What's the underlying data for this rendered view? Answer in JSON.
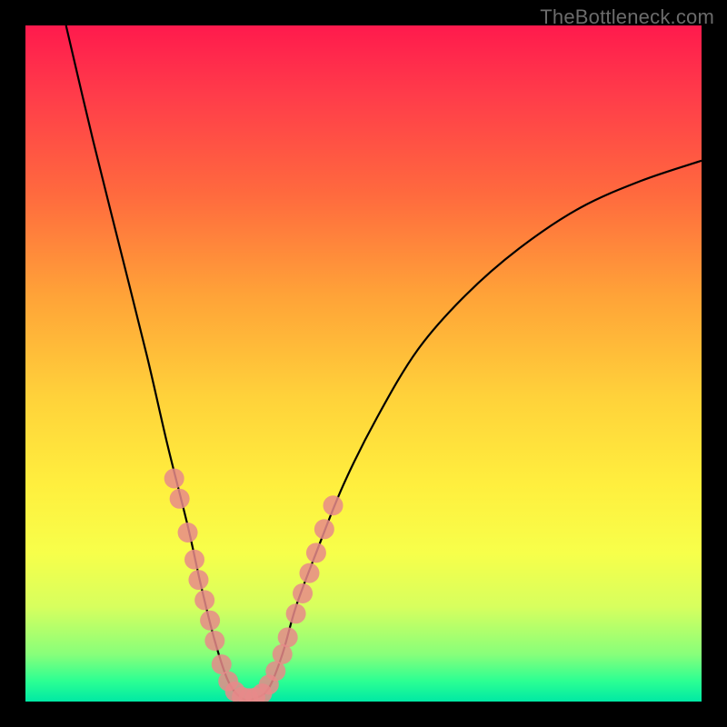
{
  "watermark": "TheBottleneck.com",
  "chart_data": {
    "type": "line",
    "title": "",
    "xlabel": "",
    "ylabel": "",
    "xlim": [
      0,
      100
    ],
    "ylim": [
      0,
      100
    ],
    "curve": {
      "name": "bottleneck-curve",
      "points": [
        {
          "x": 6,
          "y": 100
        },
        {
          "x": 10,
          "y": 83
        },
        {
          "x": 14,
          "y": 67
        },
        {
          "x": 18,
          "y": 51
        },
        {
          "x": 21,
          "y": 38
        },
        {
          "x": 24,
          "y": 26
        },
        {
          "x": 26,
          "y": 17
        },
        {
          "x": 28,
          "y": 9
        },
        {
          "x": 30,
          "y": 3
        },
        {
          "x": 32,
          "y": 0.5
        },
        {
          "x": 34,
          "y": 0.5
        },
        {
          "x": 36,
          "y": 2
        },
        {
          "x": 38,
          "y": 7
        },
        {
          "x": 40,
          "y": 14
        },
        {
          "x": 43,
          "y": 22
        },
        {
          "x": 47,
          "y": 32
        },
        {
          "x": 52,
          "y": 42
        },
        {
          "x": 58,
          "y": 52
        },
        {
          "x": 65,
          "y": 60
        },
        {
          "x": 73,
          "y": 67
        },
        {
          "x": 82,
          "y": 73
        },
        {
          "x": 91,
          "y": 77
        },
        {
          "x": 100,
          "y": 80
        }
      ]
    },
    "markers": {
      "name": "highlighted-region",
      "color": "#e78a8a",
      "radius_px": 11,
      "points": [
        {
          "x": 22.0,
          "y": 33
        },
        {
          "x": 22.8,
          "y": 30
        },
        {
          "x": 24.0,
          "y": 25
        },
        {
          "x": 25.0,
          "y": 21
        },
        {
          "x": 25.6,
          "y": 18
        },
        {
          "x": 26.5,
          "y": 15
        },
        {
          "x": 27.3,
          "y": 12
        },
        {
          "x": 28.0,
          "y": 9
        },
        {
          "x": 29.0,
          "y": 5.5
        },
        {
          "x": 30.0,
          "y": 3
        },
        {
          "x": 31.0,
          "y": 1.5
        },
        {
          "x": 32.0,
          "y": 0.7
        },
        {
          "x": 33.0,
          "y": 0.5
        },
        {
          "x": 34.0,
          "y": 0.6
        },
        {
          "x": 35.0,
          "y": 1.2
        },
        {
          "x": 36.0,
          "y": 2.5
        },
        {
          "x": 37.0,
          "y": 4.5
        },
        {
          "x": 38.0,
          "y": 7
        },
        {
          "x": 38.8,
          "y": 9.5
        },
        {
          "x": 40.0,
          "y": 13
        },
        {
          "x": 41.0,
          "y": 16
        },
        {
          "x": 42.0,
          "y": 19
        },
        {
          "x": 43.0,
          "y": 22
        },
        {
          "x": 44.2,
          "y": 25.5
        },
        {
          "x": 45.5,
          "y": 29
        }
      ]
    }
  }
}
